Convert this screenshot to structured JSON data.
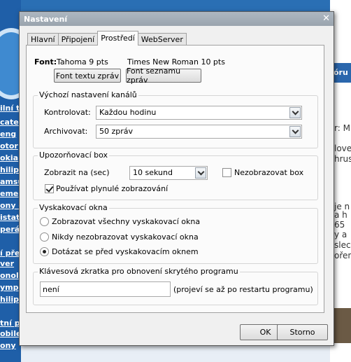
{
  "background": {
    "left_links": [
      "ilní t",
      "cate",
      "eng",
      "otor",
      "okia",
      "hilips",
      "amsu",
      "eme",
      "ony e",
      "istatr",
      "perá",
      "í pře",
      "ver",
      "onol",
      "ymp",
      "hilips",
      "tní p",
      "obile",
      "ony"
    ],
    "right_button": "óru",
    "right_texts": [
      "r: M",
      "love",
      "hrus",
      "je n",
      "a h",
      "65",
      "y a",
      "slec",
      "ořen"
    ]
  },
  "dialog": {
    "title": "Nastavení",
    "tabs": [
      {
        "label": "Hlavní",
        "active": false
      },
      {
        "label": "Připojení",
        "active": false
      },
      {
        "label": "Prostředí",
        "active": true
      },
      {
        "label": "WebServer",
        "active": false
      }
    ],
    "fonts": {
      "label": "Font:",
      "message_font": "Tahoma 9 pts",
      "list_font": "Times New Roman 10 pts",
      "message_button": "Font textu zpráv",
      "list_button": "Font seznamu zpráv"
    },
    "channel": {
      "legend": "Výchozí nastavení kanálů",
      "check_label": "Kontrolovat:",
      "check_value": "Každou hodinu",
      "archive_label": "Archivovat:",
      "archive_value": "50 zpráv"
    },
    "notify": {
      "legend": "Upozorňovací box",
      "show_label": "Zobrazit na (sec)",
      "show_value": "10 sekund",
      "hide_label": "Nezobrazovat box",
      "hide_checked": false,
      "smooth_label": "Používat plynulé zobrazování",
      "smooth_checked": true
    },
    "popups": {
      "legend": "Vyskakovací okna",
      "options": [
        {
          "label": "Zobrazovat všechny vyskakovací okna",
          "selected": false
        },
        {
          "label": "Nikdy nezobrazovat vyskakovací okna",
          "selected": false
        },
        {
          "label": "Dotázat se před vyskakovacím oknem",
          "selected": true
        }
      ]
    },
    "hotkey": {
      "legend": "Klávesová zkratka pro obnovení skrytého programu",
      "value": "není",
      "note": "(projeví se až po restartu programu)"
    },
    "ok_label": "OK",
    "cancel_label": "Storno",
    "close_glyph": "✕"
  }
}
